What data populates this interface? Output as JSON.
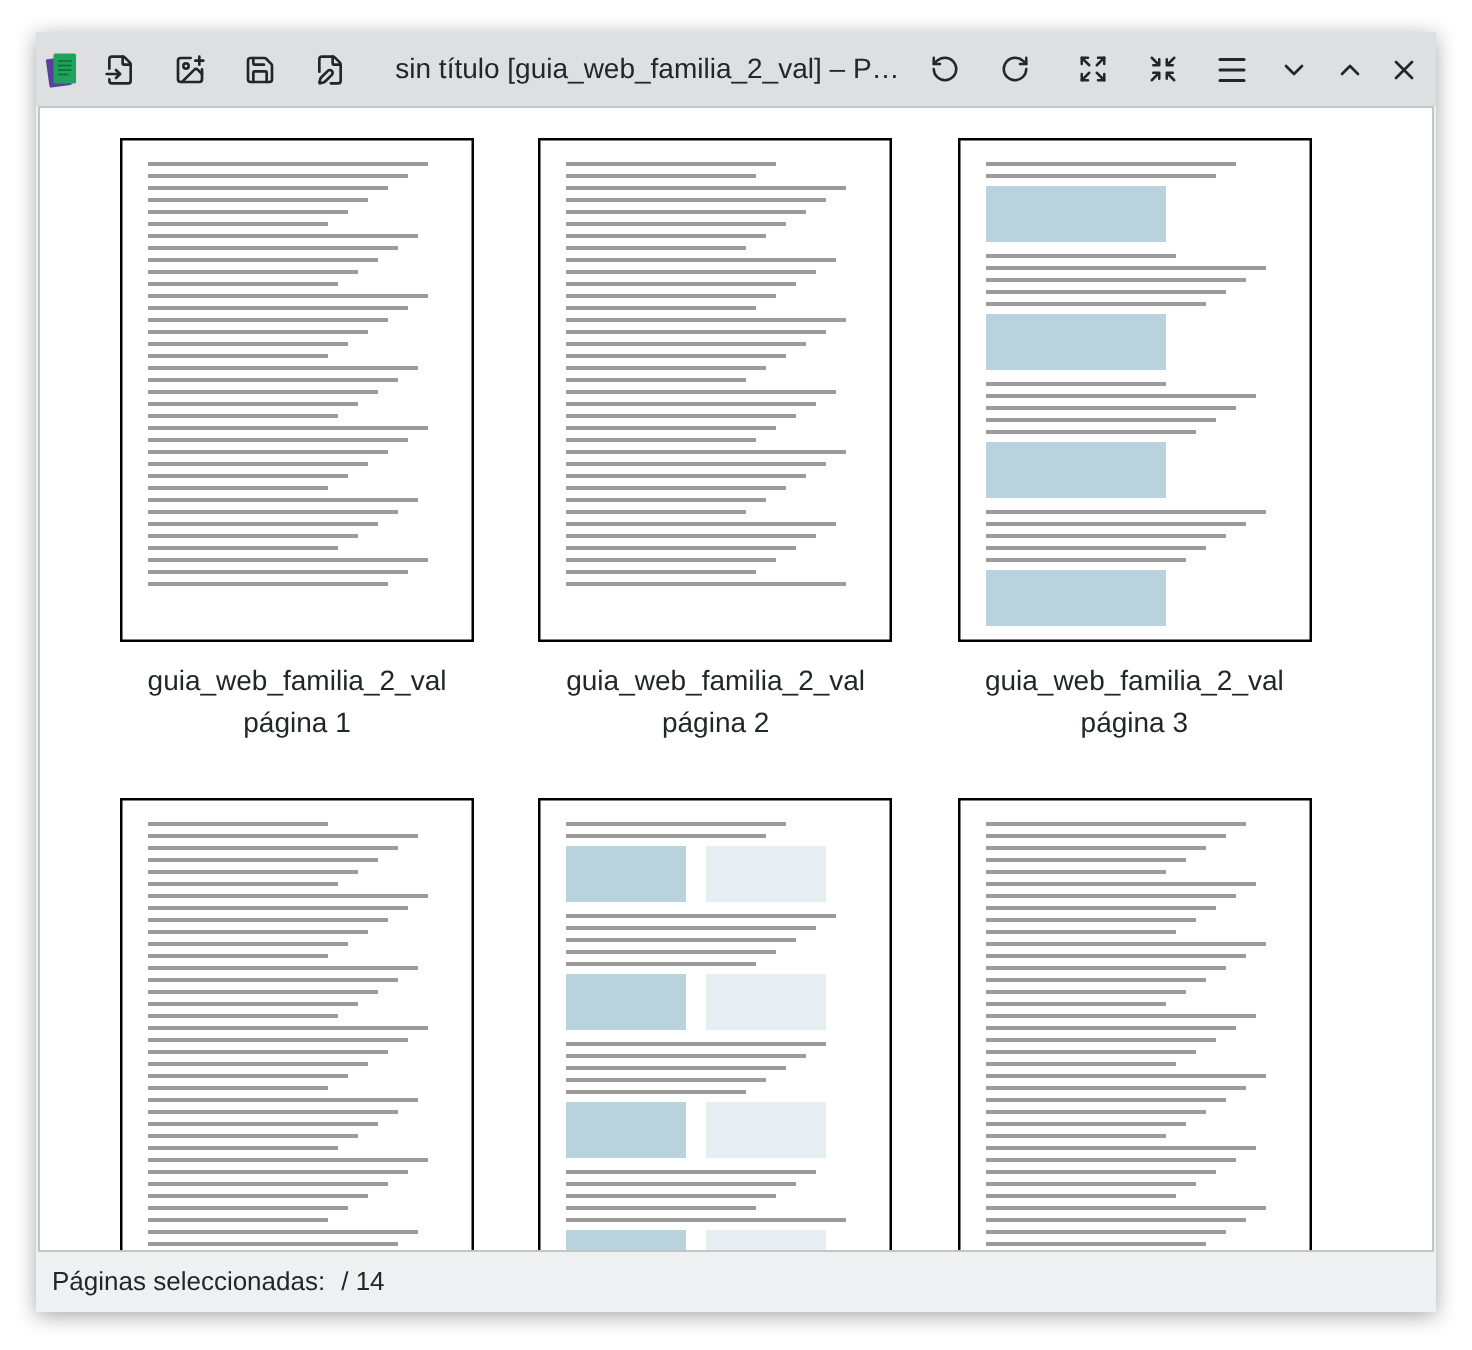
{
  "window": {
    "title": "sin título [guia_web_familia_2_val] – P…"
  },
  "pages": [
    {
      "kind": "full",
      "file": "guia_web_familia_2_val",
      "label": "página 1"
    },
    {
      "kind": "full",
      "file": "guia_web_familia_2_val",
      "label": "página 2"
    },
    {
      "kind": "full",
      "file": "guia_web_familia_2_val",
      "label": "página 3"
    },
    {
      "kind": "cut"
    },
    {
      "kind": "cut"
    },
    {
      "kind": "cut"
    }
  ],
  "status_bar": {
    "label": "Páginas seleccionadas:",
    "count": "/ 14"
  }
}
